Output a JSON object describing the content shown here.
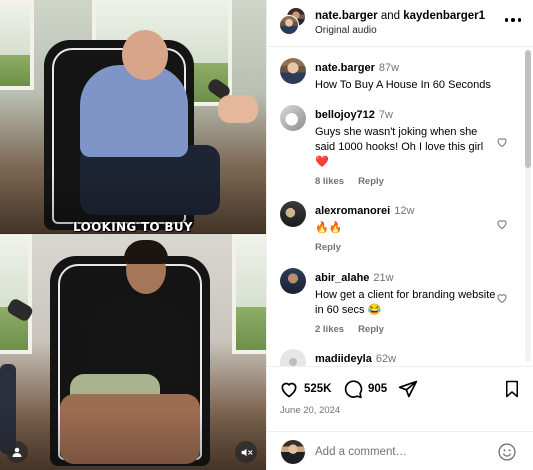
{
  "video": {
    "caption": "LOOKING TO BUY",
    "user_icon": "user-silhouette-icon",
    "mute_icon": "speaker-muted-icon"
  },
  "header": {
    "author": "nate.barger",
    "connector": "and",
    "coauthor": "kaydenbarger1",
    "audio": "Original audio",
    "more_icon": "more-horizontal-icon"
  },
  "caption_post": {
    "user": "nate.barger",
    "time": "87w",
    "text": "How To Buy A House In 60 Seconds"
  },
  "comments": [
    {
      "user": "bellojoy712",
      "time": "7w",
      "text": "Guys she wasn't joking when she said 1000 hooks! Oh I love this girl❤️",
      "likes": "8 likes",
      "reply": "Reply"
    },
    {
      "user": "alexromanorei",
      "time": "12w",
      "text": "🔥🔥",
      "likes": "",
      "reply": "Reply"
    },
    {
      "user": "abir_alahe",
      "time": "21w",
      "text": "How get a client for branding website in 60 secs 😂",
      "likes": "2 likes",
      "reply": "Reply"
    },
    {
      "user": "madiideyla",
      "time": "62w",
      "text": "",
      "likes": "",
      "reply": ""
    }
  ],
  "actions": {
    "likes": "525K",
    "comments": "905",
    "date": "June 20, 2024"
  },
  "composer": {
    "placeholder": "Add a comment…"
  },
  "colors": {
    "secondary_text": "#737373",
    "heart_red": "#ed4956",
    "border": "#efefef"
  }
}
